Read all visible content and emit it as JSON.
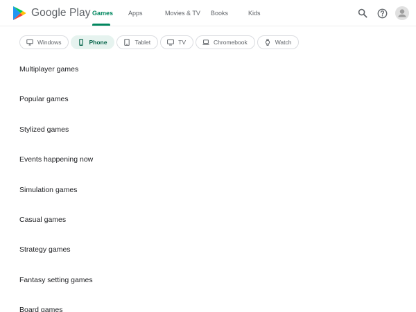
{
  "header": {
    "brand": "Google Play",
    "nav": [
      {
        "label": "Games",
        "active": true
      },
      {
        "label": "Apps",
        "active": false
      },
      {
        "label": "Movies & TV",
        "active": false
      },
      {
        "label": "Books",
        "active": false
      },
      {
        "label": "Kids",
        "active": false
      }
    ],
    "icons": [
      "search-icon",
      "help-icon",
      "account-avatar-icon"
    ],
    "accent_color": "#01875f"
  },
  "devices": [
    {
      "label": "Windows",
      "icon": "windows-monitor-icon",
      "active": false
    },
    {
      "label": "Phone",
      "icon": "phone-icon",
      "active": true
    },
    {
      "label": "Tablet",
      "icon": "tablet-icon",
      "active": false
    },
    {
      "label": "TV",
      "icon": "tv-icon",
      "active": false
    },
    {
      "label": "Chromebook",
      "icon": "laptop-icon",
      "active": false
    },
    {
      "label": "Watch",
      "icon": "watch-icon",
      "active": false
    }
  ],
  "sections": [
    "Multiplayer games",
    "Popular games",
    "Stylized games",
    "Events happening now",
    "Simulation games",
    "Casual games",
    "Strategy games",
    "Fantasy setting games",
    "Board games"
  ]
}
